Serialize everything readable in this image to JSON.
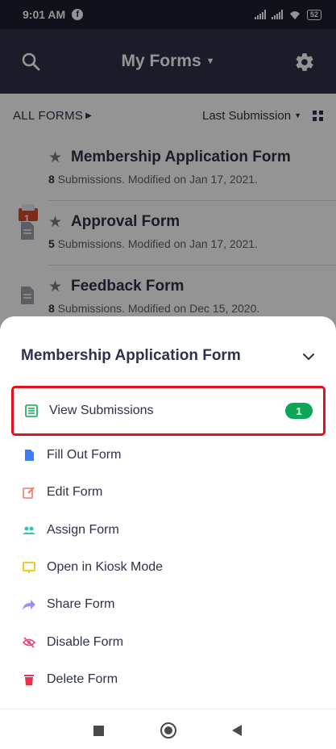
{
  "status_bar": {
    "time": "9:01 AM",
    "battery": "52"
  },
  "header": {
    "title": "My Forms"
  },
  "filter": {
    "all_forms": "ALL FORMS",
    "sort_label": "Last Submission"
  },
  "forms": [
    {
      "name": "Membership Application Form",
      "count": "8",
      "meta": " Submissions. Modified on Jan 17, 2021.",
      "badge": "1"
    },
    {
      "name": "Approval Form",
      "count": "5",
      "meta": " Submissions. Modified on Jan 17, 2021."
    },
    {
      "name": "Feedback Form",
      "count": "8",
      "meta": " Submissions. Modified on Dec 15, 2020."
    }
  ],
  "sheet": {
    "title": "Membership Application Form",
    "actions": [
      {
        "label": "View Submissions",
        "badge": "1",
        "icon": "list-icon",
        "color": "#0ca654"
      },
      {
        "label": "Fill Out Form",
        "icon": "document-icon",
        "color": "#3e7cf2"
      },
      {
        "label": "Edit Form",
        "icon": "edit-icon",
        "color": "#f07a6a"
      },
      {
        "label": "Assign Form",
        "icon": "people-icon",
        "color": "#2fc6b4"
      },
      {
        "label": "Open in Kiosk Mode",
        "icon": "monitor-icon",
        "color": "#f2c200"
      },
      {
        "label": "Share Form",
        "icon": "share-icon",
        "color": "#9b8ff0"
      },
      {
        "label": "Disable Form",
        "icon": "eye-off-icon",
        "color": "#e84b7a"
      },
      {
        "label": "Delete Form",
        "icon": "trash-icon",
        "color": "#e8334a"
      }
    ]
  },
  "colors": {
    "header_bg": "#2d3348",
    "status_bg": "#1c2030",
    "highlight": "#e3111c",
    "badge_bg": "#0ca654"
  }
}
